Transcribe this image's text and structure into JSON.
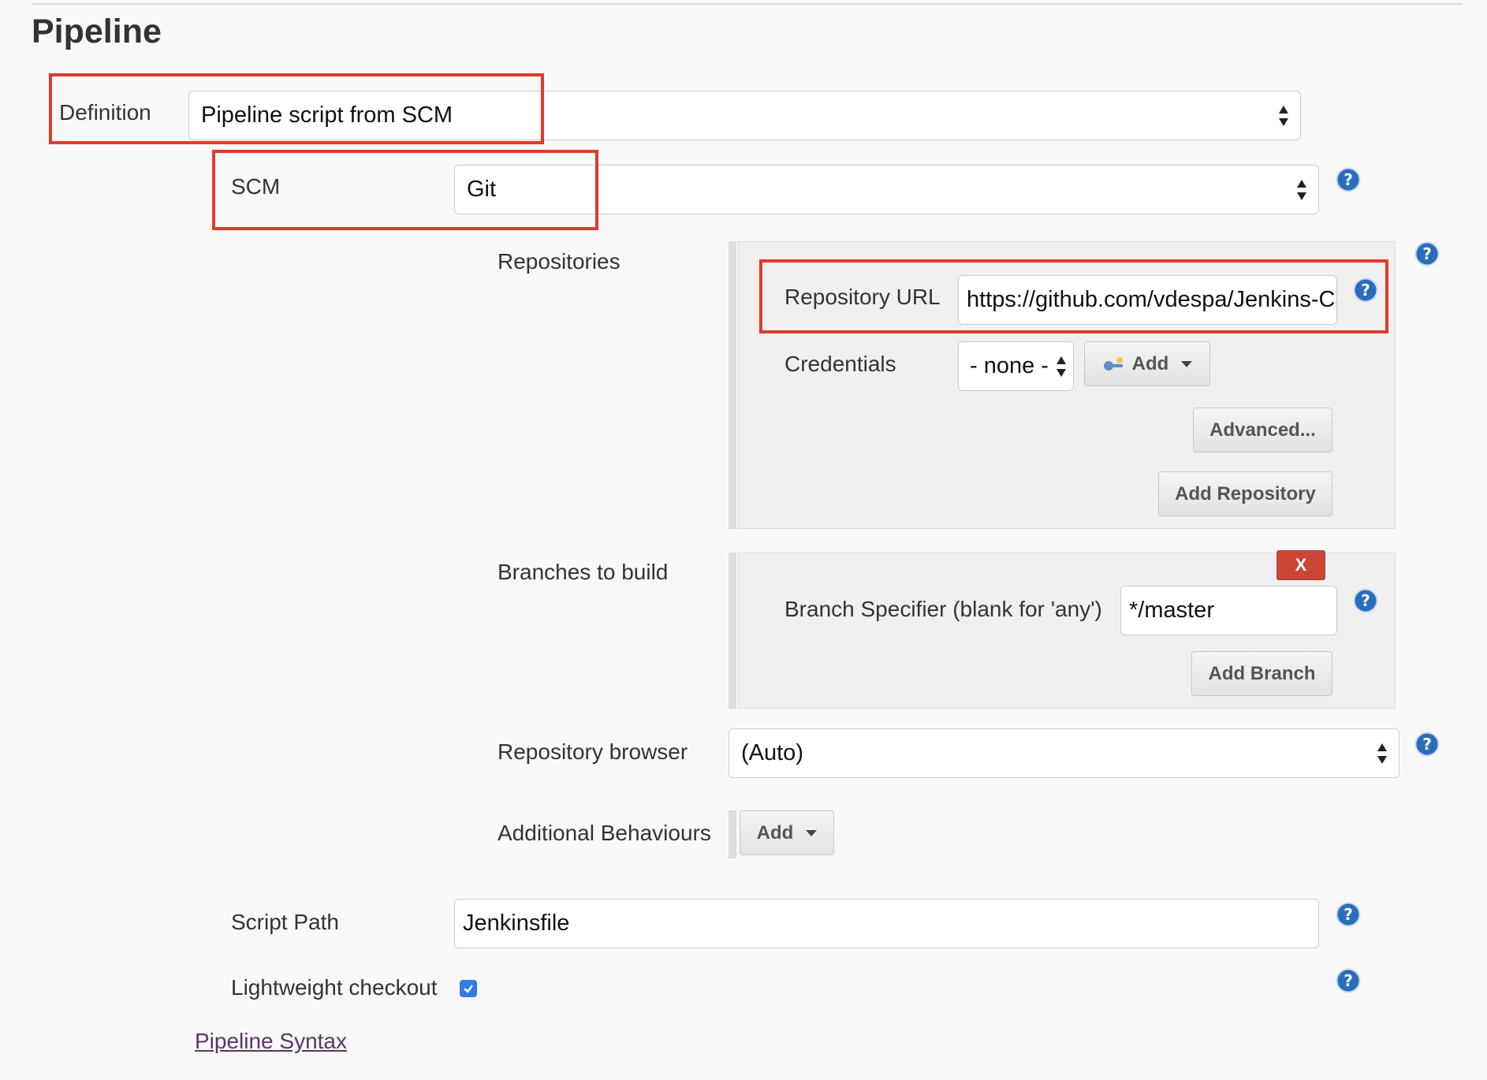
{
  "section": {
    "title": "Pipeline"
  },
  "definition": {
    "label": "Definition",
    "value": "Pipeline script from SCM"
  },
  "scm": {
    "label": "SCM",
    "value": "Git"
  },
  "repositories": {
    "label": "Repositories",
    "url_label": "Repository URL",
    "url_value": "https://github.com/vdespa/Jenkins-Ca",
    "credentials_label": "Credentials",
    "credentials_value": "- none -",
    "add_label": "Add",
    "advanced_label": "Advanced...",
    "add_repository_label": "Add Repository"
  },
  "branches": {
    "label": "Branches to build",
    "delete_label": "X",
    "specifier_label": "Branch Specifier (blank for 'any')",
    "specifier_value": "*/master",
    "add_branch_label": "Add Branch"
  },
  "repo_browser": {
    "label": "Repository browser",
    "value": "(Auto)"
  },
  "behaviours": {
    "label": "Additional Behaviours",
    "add_label": "Add"
  },
  "script_path": {
    "label": "Script Path",
    "value": "Jenkinsfile"
  },
  "lightweight": {
    "label": "Lightweight checkout",
    "checked": true
  },
  "footer": {
    "syntax_link": "Pipeline Syntax"
  },
  "colors": {
    "highlight": "#e03a2c",
    "help": "#2a6ebb",
    "checkbox": "#2f7be8",
    "delete": "#cb4537"
  }
}
